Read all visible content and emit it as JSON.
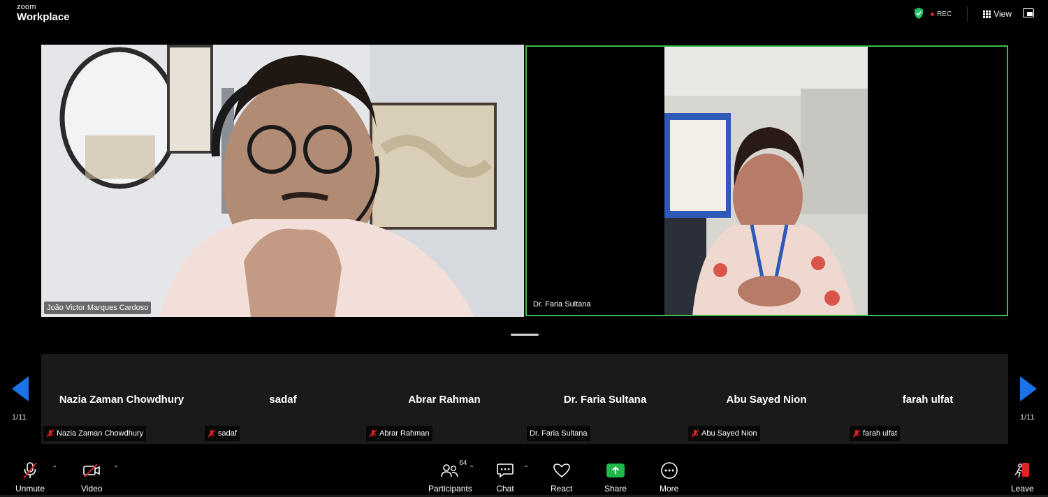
{
  "app": {
    "logo_small": "zoom",
    "logo_big": "Workplace"
  },
  "topbar": {
    "rec_label": "REC",
    "view_label": "View",
    "shield_color": "#23c26b"
  },
  "main_tiles": [
    {
      "name": "João Victor Marques Cardoso"
    },
    {
      "name": "Dr. Faria Sultana"
    }
  ],
  "gallery": {
    "page_left": "1/11",
    "page_right": "1/11",
    "tiles": [
      {
        "display_name": "Nazia Zaman Chowdhury",
        "tag": "Nazia Zaman Chowdhury",
        "muted": true
      },
      {
        "display_name": "sadaf",
        "tag": "sadaf",
        "muted": true
      },
      {
        "display_name": "Abrar Rahman",
        "tag": "Abrar Rahman",
        "muted": true
      },
      {
        "display_name": "Dr. Faria Sultana",
        "tag": "Dr. Faria Sultana",
        "muted": false
      },
      {
        "display_name": "Abu Sayed Nion",
        "tag": "Abu Sayed Nion",
        "muted": true
      },
      {
        "display_name": "farah ulfat",
        "tag": "farah ulfat",
        "muted": true
      }
    ]
  },
  "toolbar": {
    "unmute": "Unmute",
    "video": "Video",
    "participants": "Participants",
    "participants_count": "64",
    "chat": "Chat",
    "react": "React",
    "share": "Share",
    "more": "More",
    "leave": "Leave"
  },
  "colors": {
    "active_speaker_border": "#3dbb4c",
    "share_green": "#21b84a",
    "arrow_blue": "#1a73e8",
    "muted_red": "#e02424"
  }
}
